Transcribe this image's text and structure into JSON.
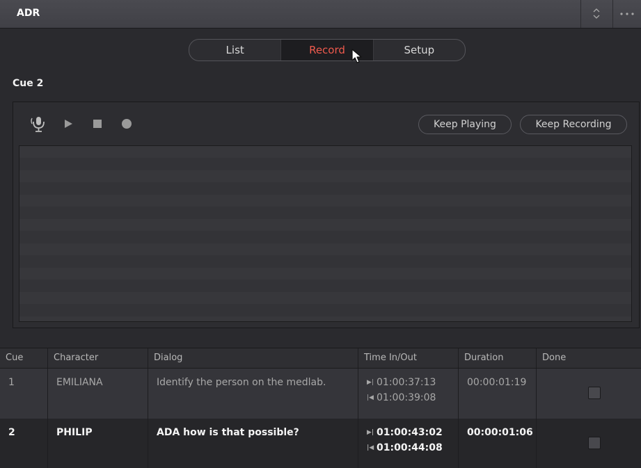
{
  "window": {
    "title": "ADR"
  },
  "tabs": [
    {
      "label": "List",
      "active": false
    },
    {
      "label": "Record",
      "active": true
    },
    {
      "label": "Setup",
      "active": false
    }
  ],
  "cue_label": "Cue 2",
  "transport": {
    "icons": [
      "mic-icon",
      "play-icon",
      "stop-icon",
      "record-icon"
    ],
    "keep_playing_label": "Keep Playing",
    "keep_recording_label": "Keep Recording"
  },
  "colors": {
    "active_tab": "#ef5a4d"
  },
  "table": {
    "headers": {
      "cue": "Cue",
      "character": "Character",
      "dialog": "Dialog",
      "time": "Time In/Out",
      "duration": "Duration",
      "done": "Done"
    },
    "rows": [
      {
        "cue": "1",
        "character": "EMILIANA",
        "dialog": "Identify the person on the medlab.",
        "time_in": "01:00:37:13",
        "time_out": "01:00:39:08",
        "duration": "00:00:01:19",
        "done": false
      },
      {
        "cue": "2",
        "character": "PHILIP",
        "dialog": "ADA how is that possible?",
        "time_in": "01:00:43:02",
        "time_out": "01:00:44:08",
        "duration": "00:00:01:06",
        "done": false
      }
    ]
  }
}
